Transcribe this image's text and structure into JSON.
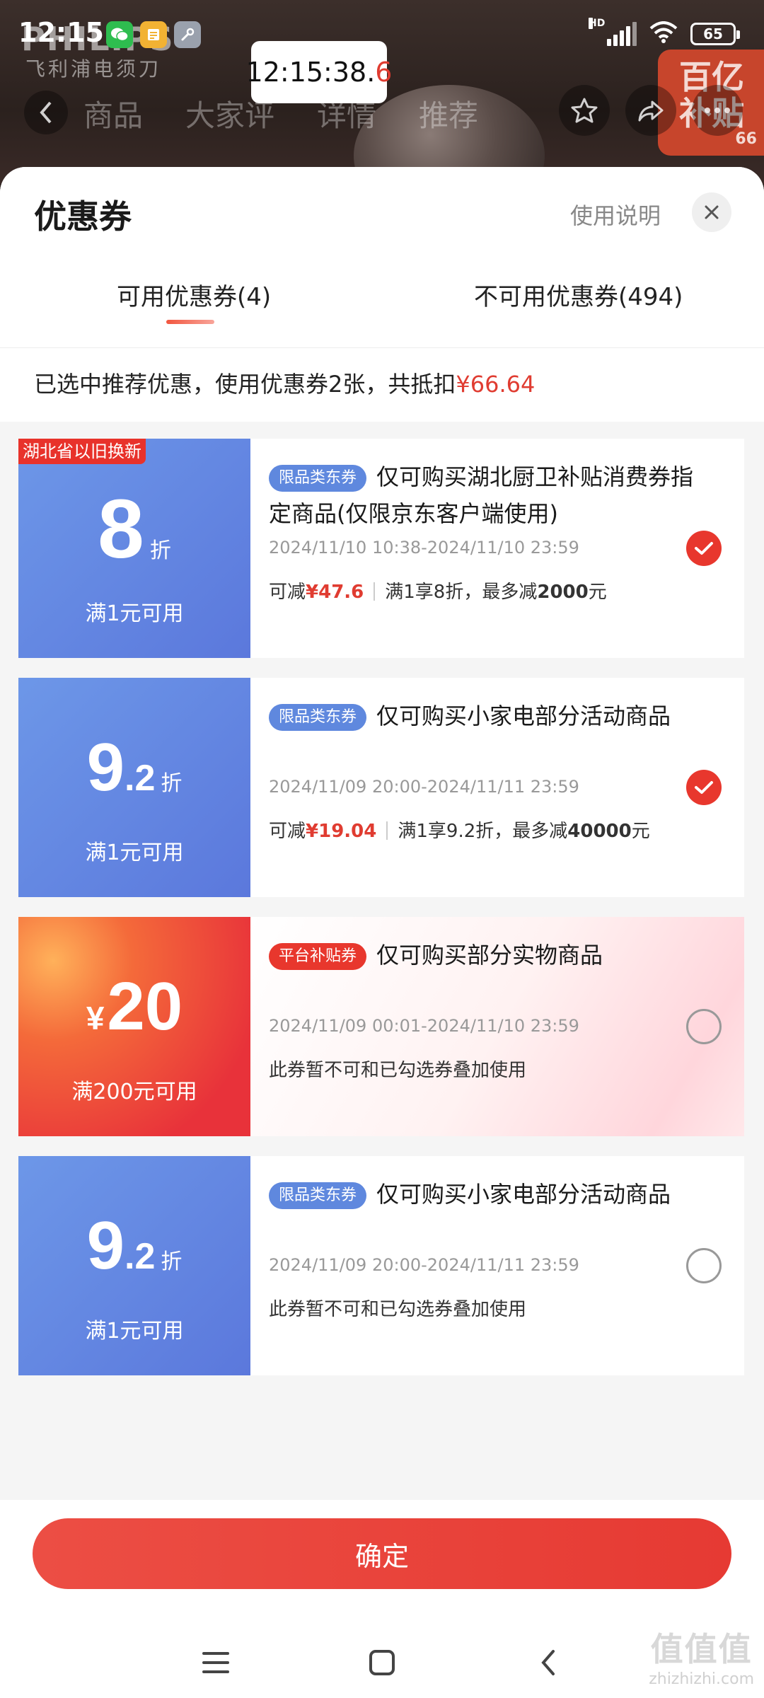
{
  "status_bar": {
    "time": "12:15",
    "network": "HD",
    "battery": "65"
  },
  "clock_overlay": {
    "time_main": "12:15:38.",
    "time_fraction": "6"
  },
  "background": {
    "brand": "PHILIPS",
    "product_name": "飞利浦电须刀",
    "badge_line1": "百亿",
    "badge_line2": "补贴",
    "badge_small": "66",
    "nav_tabs": [
      "商品",
      "大家评",
      "详情",
      "推荐"
    ]
  },
  "sheet": {
    "title": "优惠券",
    "usage_link": "使用说明",
    "tabs": {
      "available": "可用优惠券(4)",
      "unavailable": "不可用优惠券(494)"
    },
    "summary_prefix": "已选中推荐优惠，使用优惠券2张，共抵扣",
    "summary_amount": "¥66.64"
  },
  "coupons": [
    {
      "corner_tag": "湖北省以旧换新",
      "discount": "8",
      "discount_unit": "折",
      "condition": "满1元可用",
      "type_tag": "限品类东券",
      "title": "仅可购买湖北厨卫补贴消费券指定商品(仅限京东客户端使用)",
      "validity": "2024/11/10 10:38-2024/11/10 23:59",
      "save_label": "可减",
      "save_amount": "¥47.6",
      "rule": "满1享8折，最多减",
      "rule_max": "2000",
      "rule_suffix": "元",
      "selected": true
    },
    {
      "discount_int": "9",
      "discount_dec": ".2",
      "discount_unit": "折",
      "condition": "满1元可用",
      "type_tag": "限品类东券",
      "title": "仅可购买小家电部分活动商品",
      "validity": "2024/11/09 20:00-2024/11/11 23:59",
      "save_label": "可减",
      "save_amount": "¥19.04",
      "rule": "满1享9.2折，最多减",
      "rule_max": "40000",
      "rule_suffix": "元",
      "selected": true
    },
    {
      "currency": "¥",
      "amount": "20",
      "condition": "满200元可用",
      "type_tag": "平台补贴券",
      "title": "仅可购买部分实物商品",
      "validity": "2024/11/09 00:01-2024/11/10 23:59",
      "note": "此券暂不可和已勾选券叠加使用",
      "selected": false
    },
    {
      "discount_int": "9",
      "discount_dec": ".2",
      "discount_unit": "折",
      "condition": "满1元可用",
      "type_tag": "限品类东券",
      "title": "仅可购买小家电部分活动商品",
      "validity": "2024/11/09 20:00-2024/11/11 23:59",
      "note": "此券暂不可和已勾选券叠加使用",
      "selected": false
    }
  ],
  "footer": {
    "confirm": "确定"
  },
  "watermark": {
    "big": "值值值",
    "small": "zhizhizhi.com"
  },
  "colors": {
    "accent_red": "#e8372d",
    "coupon_blue": "#5b78dc",
    "tag_blue": "#5f88de"
  }
}
